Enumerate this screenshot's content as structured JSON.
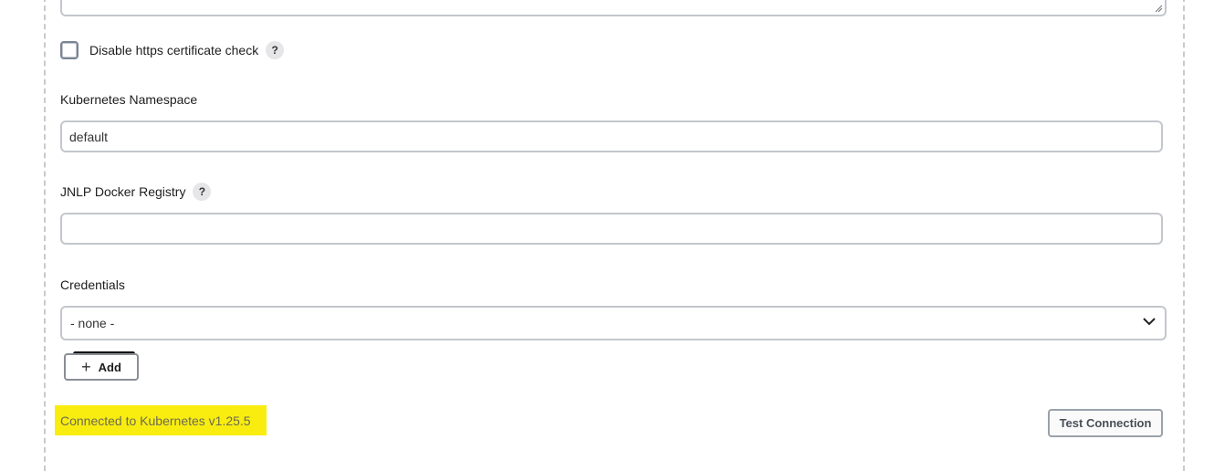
{
  "form": {
    "disable_https_check": {
      "label": "Disable https certificate check",
      "checked": false,
      "help": "?"
    },
    "namespace": {
      "label": "Kubernetes Namespace",
      "value": "default"
    },
    "jnlp_registry": {
      "label": "JNLP Docker Registry",
      "value": "",
      "help": "?"
    },
    "credentials": {
      "label": "Credentials",
      "selected": "- none -",
      "add_label": "Add"
    },
    "status_text": "Connected to Kubernetes v1.25.5",
    "test_connection_label": "Test Connection"
  },
  "icons": {
    "help": "question-icon",
    "add": "plus-icon",
    "dropdown": "chevron-down-icon",
    "resize": "resize-grip-icon"
  },
  "colors": {
    "status_highlight": "#f9ed10",
    "border": "#c3c7cc"
  }
}
